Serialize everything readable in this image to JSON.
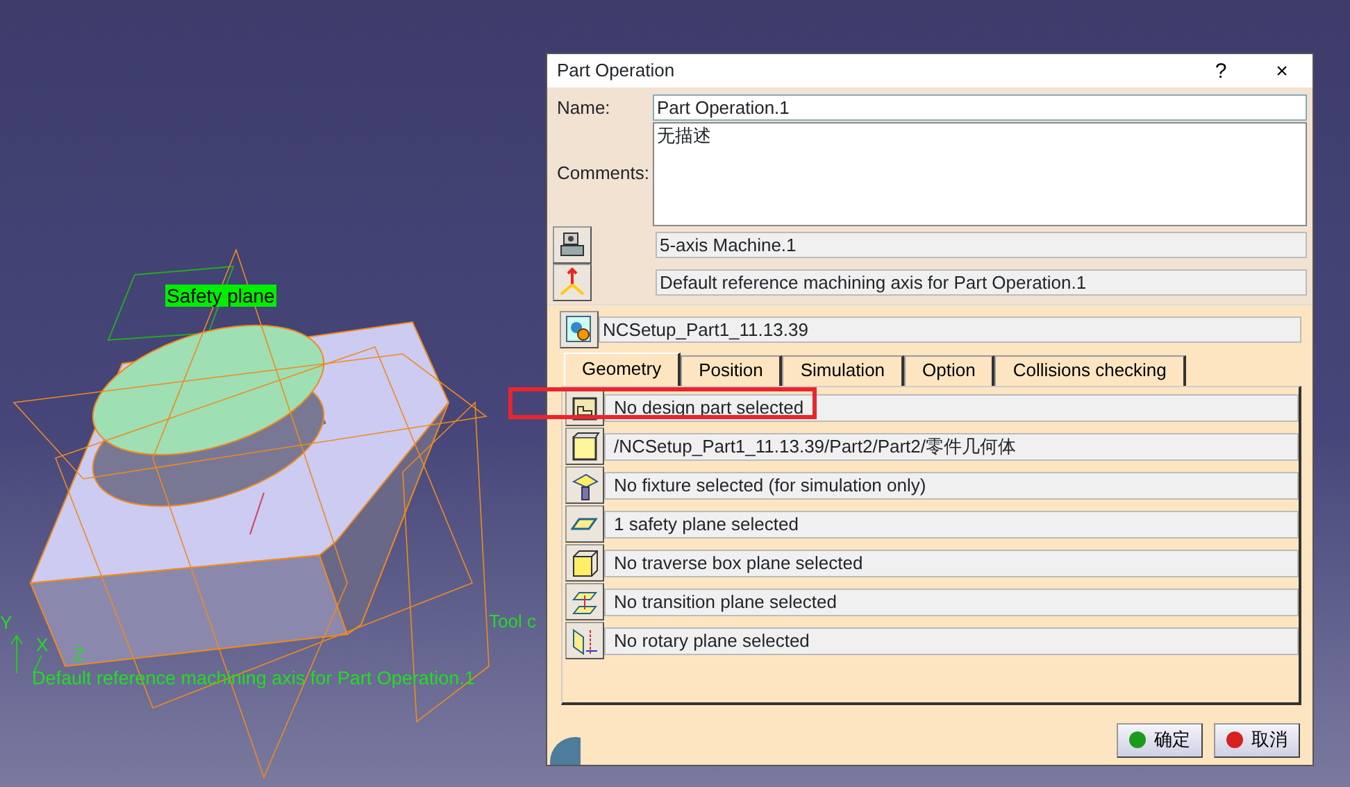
{
  "viewport": {
    "safety_label": "Safety plane",
    "tool_label": "Tool c",
    "axis_letters": [
      "Y",
      "X",
      "Z"
    ],
    "axis_label": "Default reference machining axis for Part Operation.1"
  },
  "dialog": {
    "title": "Part Operation",
    "help": "?",
    "close": "×",
    "name_label": "Name:",
    "name_value": "Part Operation.1",
    "comments_label": "Comments:",
    "comments_value": "无描述",
    "machine": "5-axis Machine.1",
    "reference_axis": "Default reference machining axis for Part Operation.1",
    "setup": "NCSetup_Part1_11.13.39",
    "tabs": [
      {
        "label": "Geometry",
        "selected": true
      },
      {
        "label": "Position",
        "selected": false
      },
      {
        "label": "Simulation",
        "selected": false
      },
      {
        "label": "Option",
        "selected": false
      },
      {
        "label": "Collisions checking",
        "selected": false
      }
    ],
    "geometry_rows": [
      {
        "kind": "design",
        "text": "No design part selected"
      },
      {
        "kind": "stock",
        "text": "/NCSetup_Part1_11.13.39/Part2/Part2/零件几何体"
      },
      {
        "kind": "fixture",
        "text": "No fixture selected (for simulation only)"
      },
      {
        "kind": "safety",
        "text": "1 safety plane selected"
      },
      {
        "kind": "traverse",
        "text": "No traverse box plane selected"
      },
      {
        "kind": "transition",
        "text": "No transition plane selected"
      },
      {
        "kind": "rotary",
        "text": "No rotary plane selected"
      }
    ],
    "buttons": [
      {
        "kind": "ok",
        "label": "确定"
      },
      {
        "kind": "cancel",
        "label": "取消"
      }
    ]
  }
}
